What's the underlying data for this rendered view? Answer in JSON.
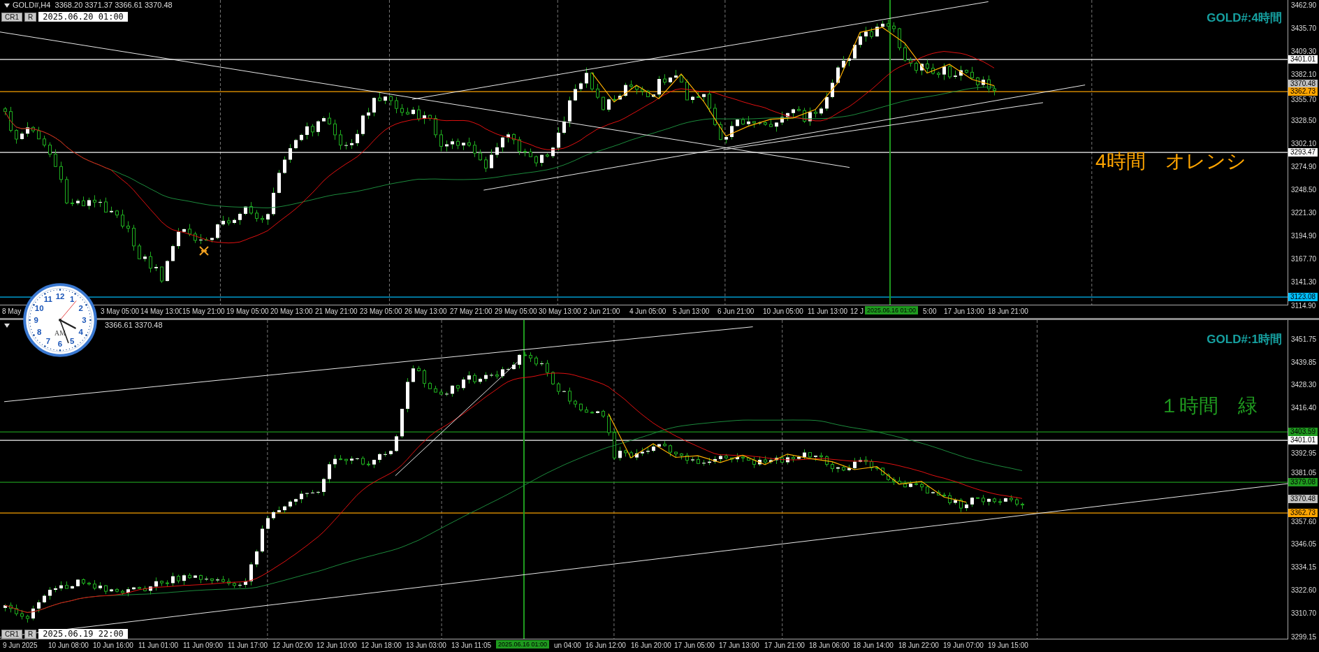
{
  "panels": [
    {
      "header": "GOLD#,H4  3368.20 3371.37 3366.61 3370.48",
      "buttons": [
        "CR1",
        "R"
      ],
      "date_field": "2025.06.20 01:00",
      "title": "GOLD#:4時間",
      "note": {
        "text": "4時間　オレンシ",
        "color": "#ffa500"
      },
      "price_labels": [
        "3462.90",
        "3435.70",
        "3409.30",
        "3382.10",
        "3355.70",
        "3328.50",
        "3302.10",
        "3274.90",
        "3248.50",
        "3221.30",
        "3194.90",
        "3167.70",
        "3141.30",
        "3114.90"
      ],
      "price_tags": [
        {
          "text": "3401.01",
          "color": "#ffffff",
          "line": true
        },
        {
          "text": "3370.48",
          "color": "#c0c0c0",
          "line": false
        },
        {
          "text": "3362.73",
          "color": "#ffa500",
          "line": true
        },
        {
          "text": "3293.47",
          "color": "#ffffff",
          "line": true
        },
        {
          "text": "3123.08",
          "color": "#00bfff",
          "line": true
        }
      ],
      "time_labels": [
        "8 May",
        "3 May 05:00",
        "14 May 13:00",
        "15 May 21:00",
        "19 May 05:00",
        "20 May 13:00",
        "21 May 21:00",
        "23 May 05:00",
        "26 May 13:00",
        "27 May 21:00",
        "29 May 05:00",
        "30 May 13:00",
        "2 Jun 21:00",
        "4 Jun 05:00",
        "5 Jun 13:00",
        "6 Jun 21:00",
        "10 Jun 05:00",
        "11 Jun 13:00",
        "12 J",
        "5:00",
        "17 Jun 13:00",
        "18 Jun 21:00"
      ],
      "cursor_time": "2025.06.16 01:00"
    },
    {
      "header": "3366.61 3370.48",
      "buttons": [
        "CR1",
        "R"
      ],
      "date_field": "2025.06.19 22:00",
      "title": "GOLD#:1時間",
      "note": {
        "text": "１時間　緑",
        "color": "#1f9a1f"
      },
      "price_labels": [
        "3451.75",
        "3439.85",
        "3428.30",
        "3416.40",
        "3392.95",
        "3381.05",
        "3357.60",
        "3346.05",
        "3334.15",
        "3322.60",
        "3310.70",
        "3299.15"
      ],
      "price_tags": [
        {
          "text": "3403.59",
          "color": "#1f9a1f",
          "line": true
        },
        {
          "text": "3401.01",
          "color": "#ffffff",
          "line": true
        },
        {
          "text": "3379.08",
          "color": "#1f9a1f",
          "line": true
        },
        {
          "text": "3370.48",
          "color": "#c0c0c0",
          "line": false
        },
        {
          "text": "3362.73",
          "color": "#ffa500",
          "line": true
        }
      ],
      "time_labels": [
        "9 Jun 2025",
        "10 Jun 08:00",
        "10 Jun 16:00",
        "11 Jun 01:00",
        "11 Jun 09:00",
        "11 Jun 17:00",
        "12 Jun 02:00",
        "12 Jun 10:00",
        "12 Jun 18:00",
        "13 Jun 03:00",
        "13 Jun 11:05",
        "un 04:00",
        "16 Jun 12:00",
        "16 Jun 20:00",
        "17 Jun 05:00",
        "17 Jun 13:00",
        "17 Jun 21:00",
        "18 Jun 06:00",
        "18 Jun 14:00",
        "18 Jun 22:00",
        "19 Jun 07:00",
        "19 Jun 15:00"
      ],
      "cursor_time": "2025.06.16 01:00"
    }
  ],
  "clock": {
    "numerals": [
      "11",
      "12",
      "1",
      "10",
      "2",
      "9",
      "3",
      "8",
      "4",
      "7",
      "6",
      "5"
    ],
    "label": "AM"
  }
}
